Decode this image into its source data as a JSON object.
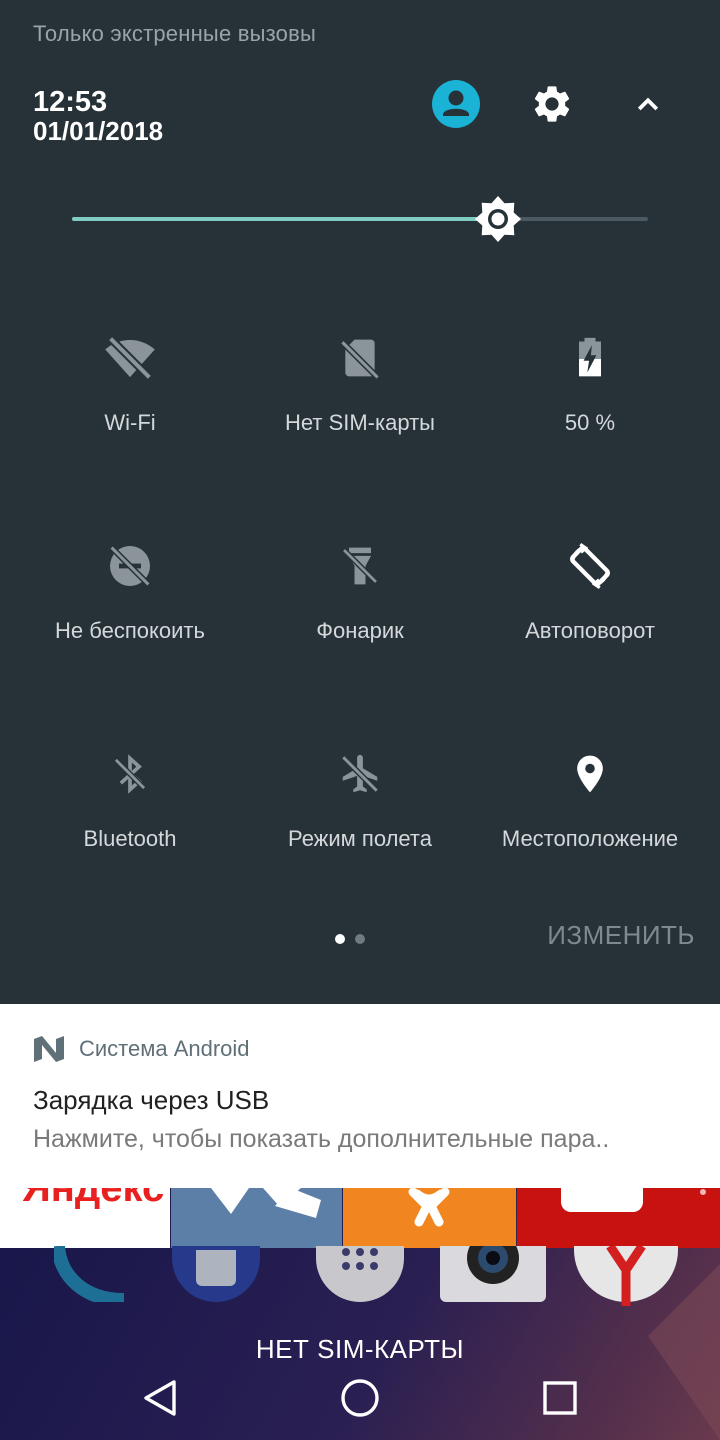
{
  "status": {
    "carrier_text": "Только экстренные вызовы",
    "time": "12:53",
    "date": "01/01/2018"
  },
  "header_icons": {
    "user": "account-circle-icon",
    "settings": "gear-icon",
    "collapse": "chevron-up-icon"
  },
  "brightness": {
    "level": 0.74,
    "accent": "#80cbc4"
  },
  "tiles": [
    {
      "label": "Wi-Fi",
      "icon": "wifi-off-icon",
      "active": false
    },
    {
      "label": "Нет SIM-карты",
      "icon": "no-sim-icon",
      "active": false
    },
    {
      "label": "50 %",
      "icon": "battery-charging-icon",
      "active": true
    },
    {
      "label": "Не беспокоить",
      "icon": "do-not-disturb-off-icon",
      "active": false
    },
    {
      "label": "Фонарик",
      "icon": "flashlight-off-icon",
      "active": false
    },
    {
      "label": "Автоповорот",
      "icon": "auto-rotate-icon",
      "active": true
    },
    {
      "label": "Bluetooth",
      "icon": "bluetooth-off-icon",
      "active": false
    },
    {
      "label": "Режим полета",
      "icon": "airplane-off-icon",
      "active": false
    },
    {
      "label": "Местоположение",
      "icon": "location-icon",
      "active": true
    }
  ],
  "pager": {
    "pages": 2,
    "current": 1
  },
  "edit_label": "ИЗМЕНИТЬ",
  "notification": {
    "app_name": "Система Android",
    "title": "Зарядка через USB",
    "text": "Нажмите, чтобы показать дополнительные пара.."
  },
  "home": {
    "banner_text": "Яндекс",
    "no_sim_text": "НЕТ SIM-КАРТЫ"
  },
  "colors": {
    "panel_bg": "#263238",
    "tile_on": "#ffffff",
    "tile_off": "#8a9499",
    "accent_user": "#1ab3d6"
  }
}
